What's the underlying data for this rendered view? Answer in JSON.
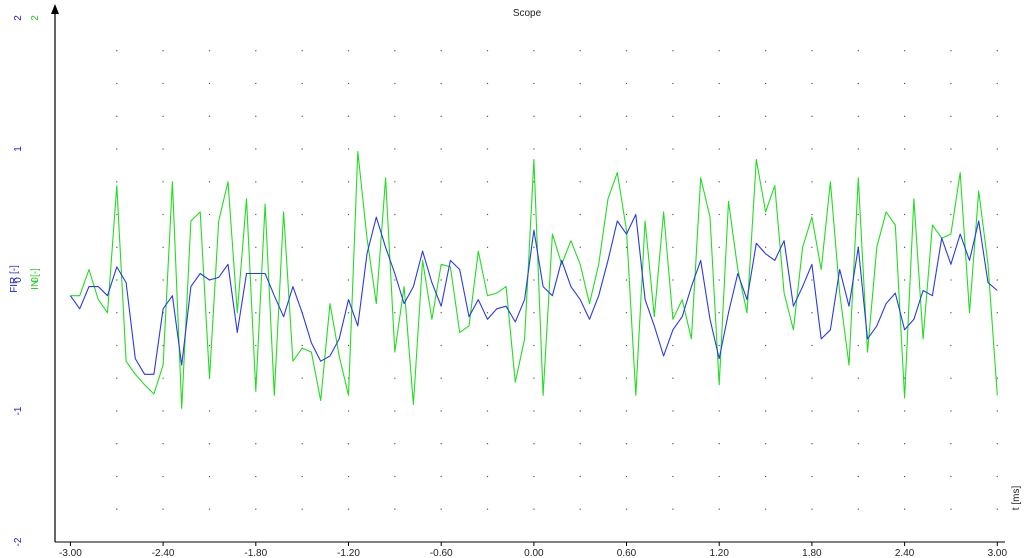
{
  "window": {
    "title": "Scope"
  },
  "chart_data": {
    "type": "line",
    "title": "Scope",
    "xlabel": "t [ms]",
    "ylabels": [
      {
        "text": "FIR [-]",
        "color": "#2020d0"
      },
      {
        "text": "IN [-]",
        "color": "#22cc22"
      }
    ],
    "xlim": [
      -3.1,
      3.05
    ],
    "ylim": [
      -2,
      2
    ],
    "xticks": [
      {
        "v": -3.0,
        "label": "-3.00"
      },
      {
        "v": -2.4,
        "label": "-2.40"
      },
      {
        "v": -1.8,
        "label": "-1.80"
      },
      {
        "v": -1.2,
        "label": "-1.20"
      },
      {
        "v": -0.6,
        "label": "-0.60"
      },
      {
        "v": 0.0,
        "label": "0.00"
      },
      {
        "v": 0.6,
        "label": "0.60"
      },
      {
        "v": 1.2,
        "label": "1.20"
      },
      {
        "v": 1.8,
        "label": "1.80"
      },
      {
        "v": 2.4,
        "label": "2.40"
      },
      {
        "v": 3.0,
        "label": "3.00"
      }
    ],
    "yticks_fir": [
      {
        "v": 2,
        "label": "2"
      },
      {
        "v": 1,
        "label": "1"
      },
      {
        "v": 0,
        "label": "0"
      },
      {
        "v": -1,
        "label": "-1"
      },
      {
        "v": -2,
        "label": "-2"
      }
    ],
    "yticks_in": [
      {
        "v": 2,
        "label": "2"
      },
      {
        "v": 0,
        "label": "0"
      }
    ],
    "grid": true,
    "x": [
      -3.0,
      -2.94,
      -2.88,
      -2.82,
      -2.76,
      -2.7,
      -2.64,
      -2.58,
      -2.52,
      -2.46,
      -2.4,
      -2.34,
      -2.28,
      -2.22,
      -2.16,
      -2.1,
      -2.04,
      -1.98,
      -1.92,
      -1.86,
      -1.8,
      -1.74,
      -1.68,
      -1.62,
      -1.56,
      -1.5,
      -1.44,
      -1.38,
      -1.32,
      -1.26,
      -1.2,
      -1.14,
      -1.08,
      -1.02,
      -0.96,
      -0.9,
      -0.84,
      -0.78,
      -0.72,
      -0.66,
      -0.6,
      -0.54,
      -0.48,
      -0.42,
      -0.36,
      -0.3,
      -0.24,
      -0.18,
      -0.12,
      -0.06,
      0.0,
      0.06,
      0.12,
      0.18,
      0.24,
      0.3,
      0.36,
      0.42,
      0.48,
      0.54,
      0.6,
      0.66,
      0.72,
      0.78,
      0.84,
      0.9,
      0.96,
      1.02,
      1.08,
      1.14,
      1.2,
      1.26,
      1.32,
      1.38,
      1.44,
      1.5,
      1.56,
      1.62,
      1.68,
      1.74,
      1.8,
      1.86,
      1.92,
      1.98,
      2.04,
      2.1,
      2.16,
      2.22,
      2.28,
      2.34,
      2.4,
      2.46,
      2.52,
      2.58,
      2.64,
      2.7,
      2.76,
      2.82,
      2.88,
      2.94,
      3.0
    ],
    "series": [
      {
        "name": "IN [-]",
        "color": "#22dd22",
        "values": [
          -0.12,
          -0.12,
          0.08,
          -0.15,
          -0.25,
          0.72,
          -0.62,
          -0.72,
          -0.8,
          -0.87,
          -0.65,
          0.75,
          -0.98,
          0.45,
          0.52,
          -0.75,
          0.45,
          0.75,
          -0.25,
          0.62,
          -0.85,
          0.58,
          -0.88,
          0.52,
          -0.62,
          -0.52,
          -0.55,
          -0.92,
          -0.18,
          -0.58,
          -0.88,
          0.98,
          0.32,
          -0.18,
          0.78,
          -0.55,
          -0.05,
          -0.95,
          0.15,
          -0.3,
          0.12,
          0.1,
          -0.4,
          -0.35,
          0.22,
          -0.12,
          -0.1,
          -0.05,
          -0.78,
          -0.45,
          0.92,
          -0.88,
          0.35,
          0.12,
          0.3,
          0.12,
          -0.18,
          0.12,
          0.62,
          0.82,
          0.38,
          -0.88,
          0.45,
          -0.28,
          0.52,
          -0.3,
          -0.15,
          -0.45,
          0.78,
          0.48,
          -0.8,
          0.6,
          0.08,
          -0.25,
          0.92,
          0.52,
          0.72,
          -0.1,
          -0.38,
          0.25,
          0.48,
          0.08,
          0.75,
          -0.1,
          -0.65,
          0.78,
          -0.55,
          0.25,
          0.52,
          0.42,
          -0.9,
          0.62,
          -0.45,
          0.42,
          0.32,
          0.35,
          0.82,
          -0.25,
          0.68,
          0.12,
          -0.88
        ]
      },
      {
        "name": "FIR [-]",
        "color": "#2a3ae0",
        "values": [
          -0.12,
          -0.22,
          -0.05,
          -0.05,
          -0.12,
          0.1,
          -0.02,
          -0.6,
          -0.72,
          -0.72,
          -0.22,
          -0.12,
          -0.65,
          -0.05,
          0.05,
          0.0,
          0.02,
          0.12,
          -0.4,
          0.05,
          0.05,
          0.05,
          -0.12,
          -0.28,
          -0.05,
          -0.25,
          -0.48,
          -0.62,
          -0.58,
          -0.45,
          -0.15,
          -0.35,
          0.2,
          0.48,
          0.25,
          0.05,
          -0.18,
          -0.05,
          0.22,
          -0.02,
          -0.2,
          0.15,
          0.08,
          -0.28,
          -0.15,
          -0.3,
          -0.22,
          -0.2,
          -0.32,
          -0.15,
          0.38,
          -0.05,
          -0.12,
          0.15,
          -0.05,
          -0.15,
          -0.3,
          -0.12,
          0.15,
          0.45,
          0.35,
          0.5,
          -0.15,
          -0.35,
          -0.58,
          -0.38,
          -0.28,
          -0.05,
          0.15,
          -0.3,
          -0.6,
          -0.25,
          0.05,
          -0.15,
          0.28,
          0.2,
          0.15,
          0.3,
          -0.2,
          -0.05,
          0.12,
          -0.45,
          -0.38,
          0.08,
          -0.2,
          0.25,
          -0.45,
          -0.35,
          -0.18,
          -0.1,
          -0.38,
          -0.3,
          -0.08,
          -0.12,
          0.32,
          0.12,
          0.35,
          0.15,
          0.45,
          -0.02,
          -0.08
        ]
      }
    ]
  }
}
